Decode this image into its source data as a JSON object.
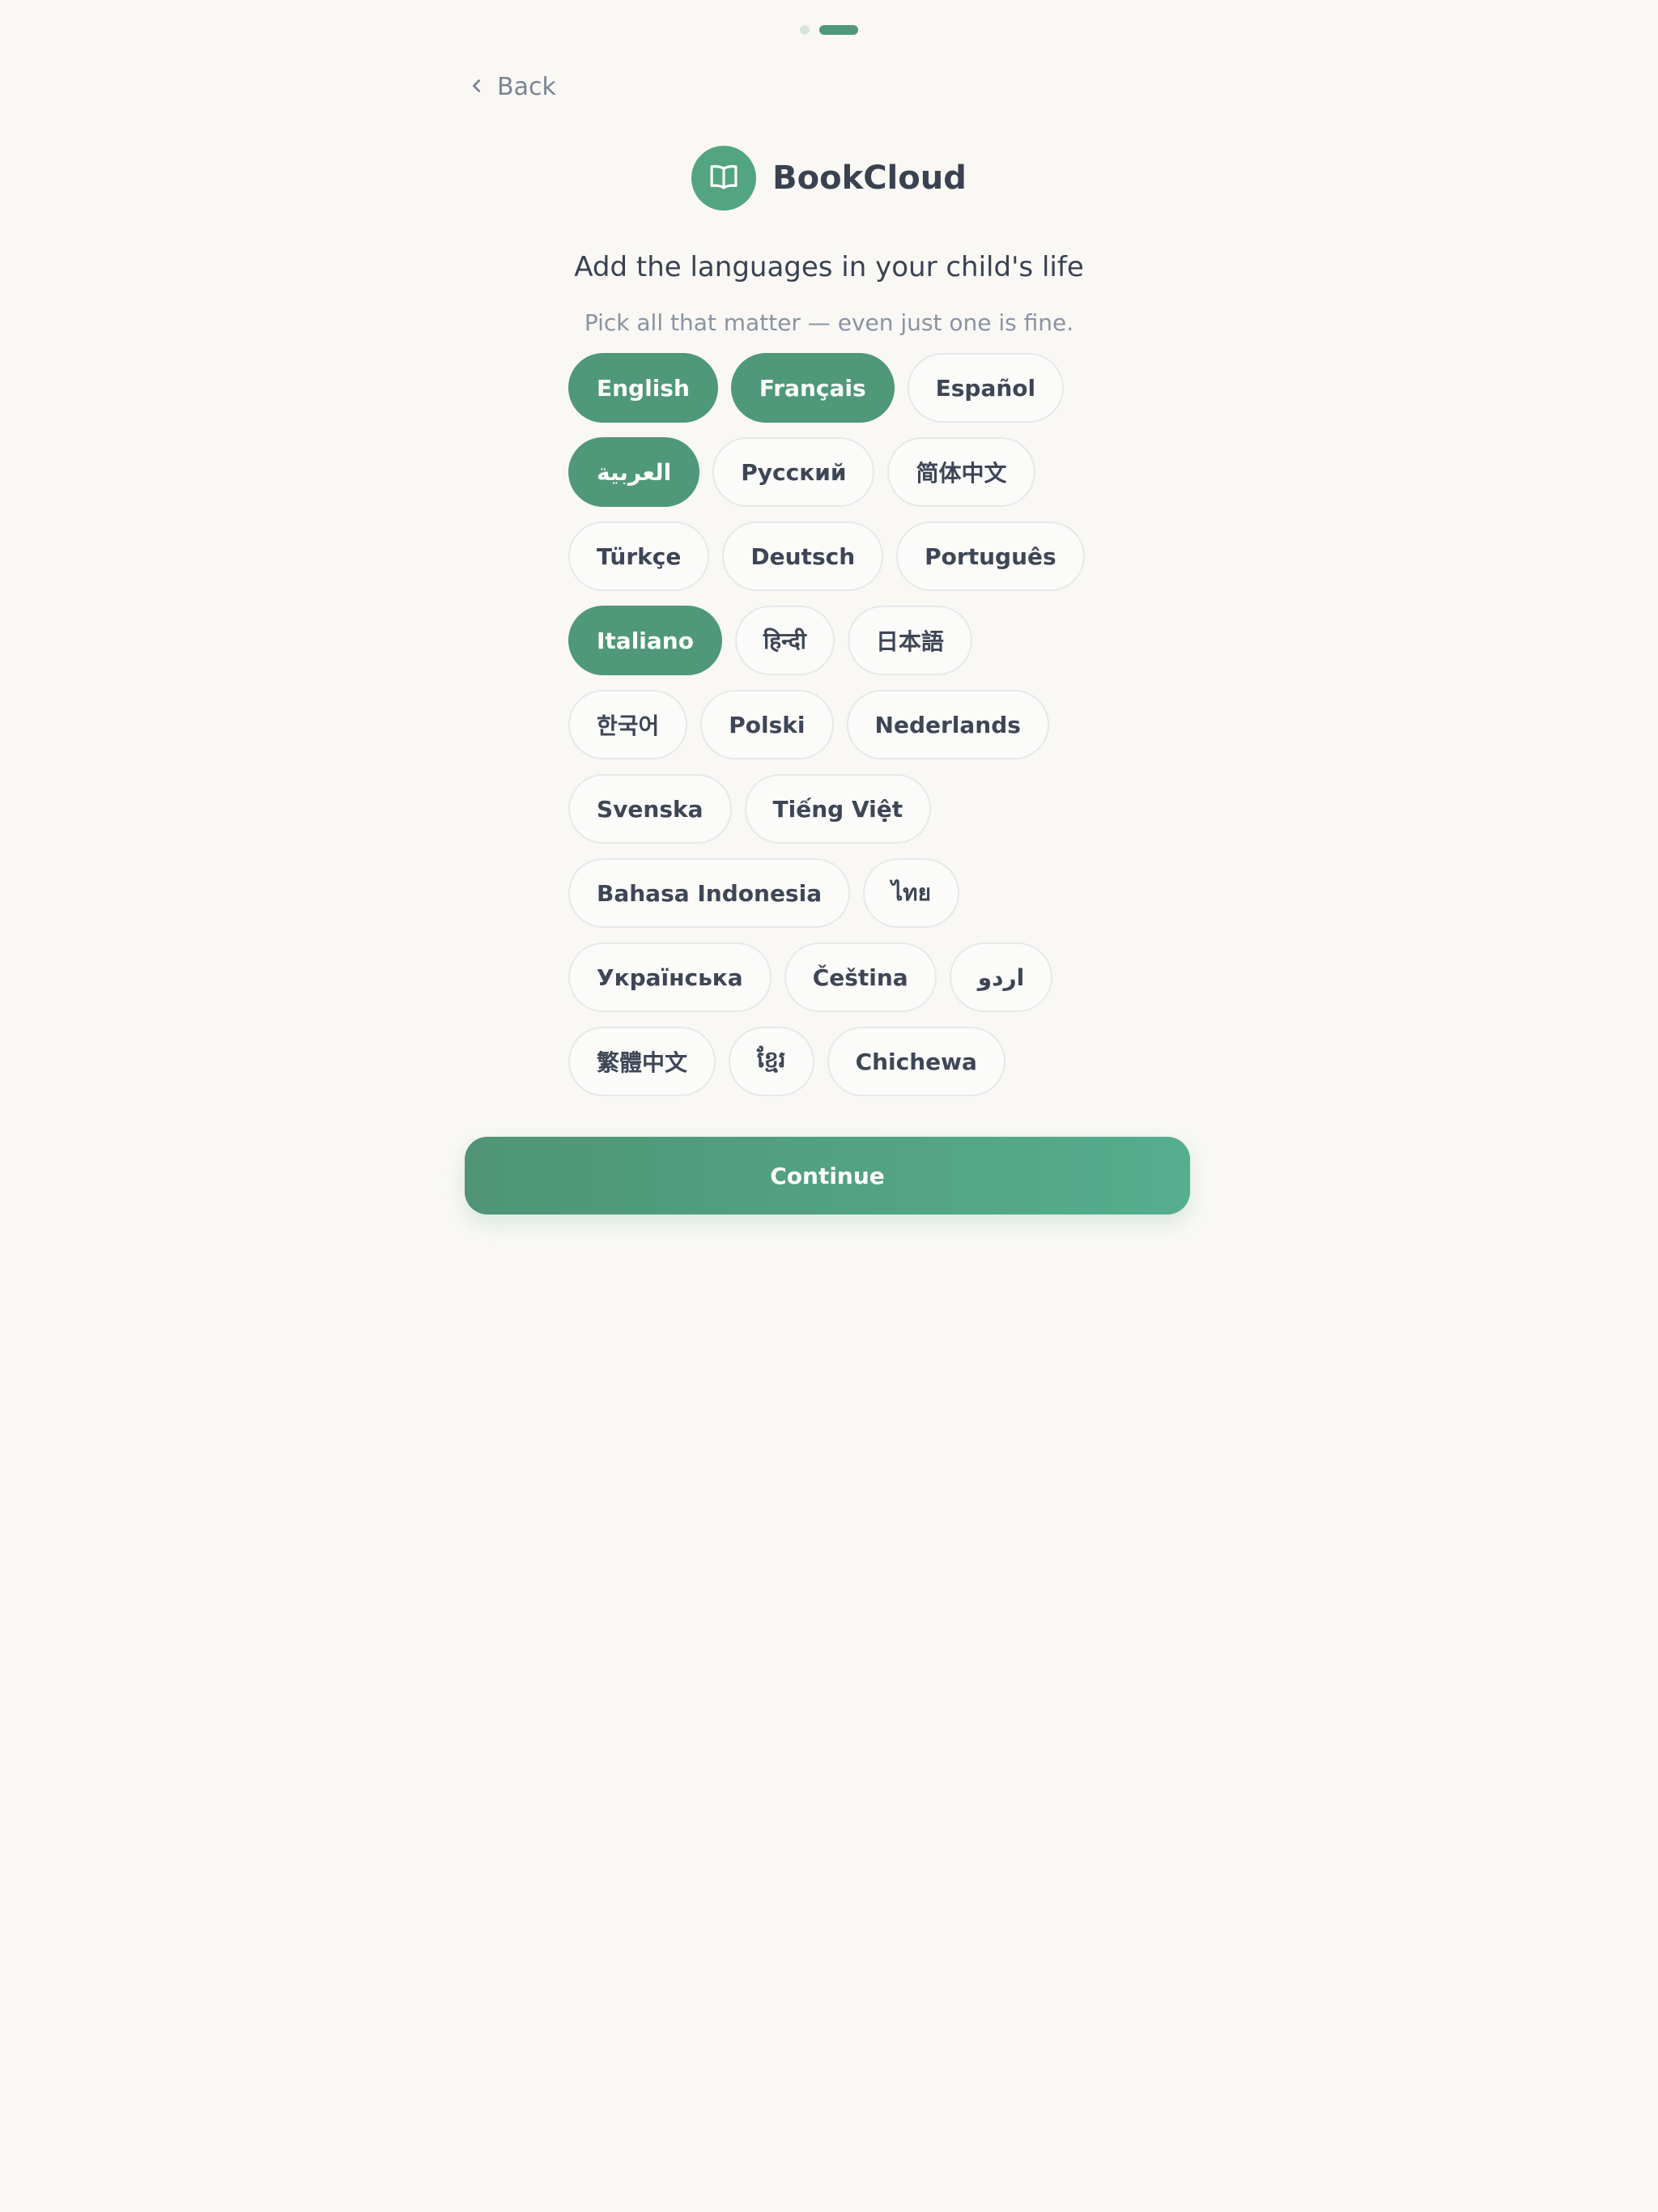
{
  "progress": {
    "total_steps": 2,
    "current_step": 2
  },
  "nav": {
    "back_label": "Back"
  },
  "brand": {
    "name": "BookCloud",
    "logo_icon": "open-book-icon",
    "accent_color": "#4f987a"
  },
  "heading": "Add the languages in your child's life",
  "subheading": "Pick all that matter — even just one is fine.",
  "languages": [
    [
      {
        "label": "English",
        "selected": true
      },
      {
        "label": "Français",
        "selected": true
      },
      {
        "label": "Español",
        "selected": false
      }
    ],
    [
      {
        "label": "العربية",
        "selected": true
      },
      {
        "label": "Русский",
        "selected": false
      },
      {
        "label": "简体中文",
        "selected": false
      }
    ],
    [
      {
        "label": "Türkçe",
        "selected": false
      },
      {
        "label": "Deutsch",
        "selected": false
      },
      {
        "label": "Português",
        "selected": false
      }
    ],
    [
      {
        "label": "Italiano",
        "selected": true
      },
      {
        "label": "हिन्दी",
        "selected": false
      },
      {
        "label": "日本語",
        "selected": false
      }
    ],
    [
      {
        "label": "한국어",
        "selected": false
      },
      {
        "label": "Polski",
        "selected": false
      },
      {
        "label": "Nederlands",
        "selected": false
      }
    ],
    [
      {
        "label": "Svenska",
        "selected": false
      },
      {
        "label": "Tiếng Việt",
        "selected": false
      }
    ],
    [
      {
        "label": "Bahasa Indonesia",
        "selected": false
      },
      {
        "label": "ไทย",
        "selected": false
      }
    ],
    [
      {
        "label": "Українська",
        "selected": false
      },
      {
        "label": "Čeština",
        "selected": false
      },
      {
        "label": "اردو",
        "selected": false
      }
    ],
    [
      {
        "label": "繁體中文",
        "selected": false
      },
      {
        "label": "ខ្មែរ",
        "selected": false
      },
      {
        "label": "Chichewa",
        "selected": false
      }
    ]
  ],
  "continue_label": "Continue"
}
